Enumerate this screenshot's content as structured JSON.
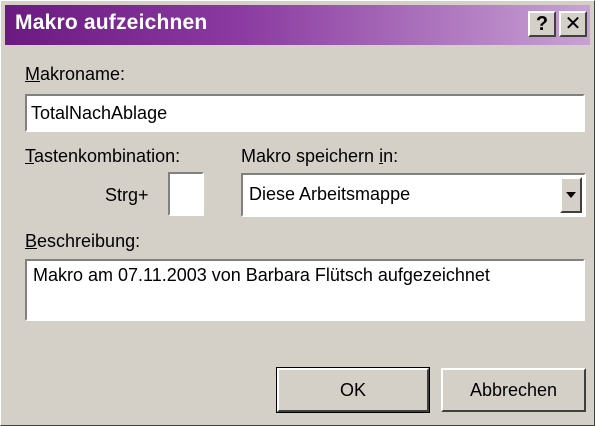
{
  "window": {
    "title": "Makro aufzeichnen",
    "help_glyph": "?",
    "close_glyph": "✕"
  },
  "macro_name": {
    "label_mnemonic": "M",
    "label_rest": "akroname:",
    "value": "TotalNachAblage"
  },
  "shortcut": {
    "label_mnemonic": "T",
    "label_rest": "astenkombination:",
    "prefix": "Strg+",
    "value": ""
  },
  "store_in": {
    "label_before": "Makro speichern ",
    "label_mnemonic": "i",
    "label_after": "n:",
    "selected": "Diese Arbeitsmappe"
  },
  "description": {
    "label_mnemonic": "B",
    "label_rest": "eschreibung:",
    "value": "Makro am 07.11.2003 von Barbara Flütsch aufgezeichnet"
  },
  "buttons": {
    "ok": "OK",
    "cancel": "Abbrechen"
  },
  "colors": {
    "titlebar_start": "#6b1a82",
    "titlebar_end": "#c8a2d4",
    "face": "#d4d0c8"
  }
}
